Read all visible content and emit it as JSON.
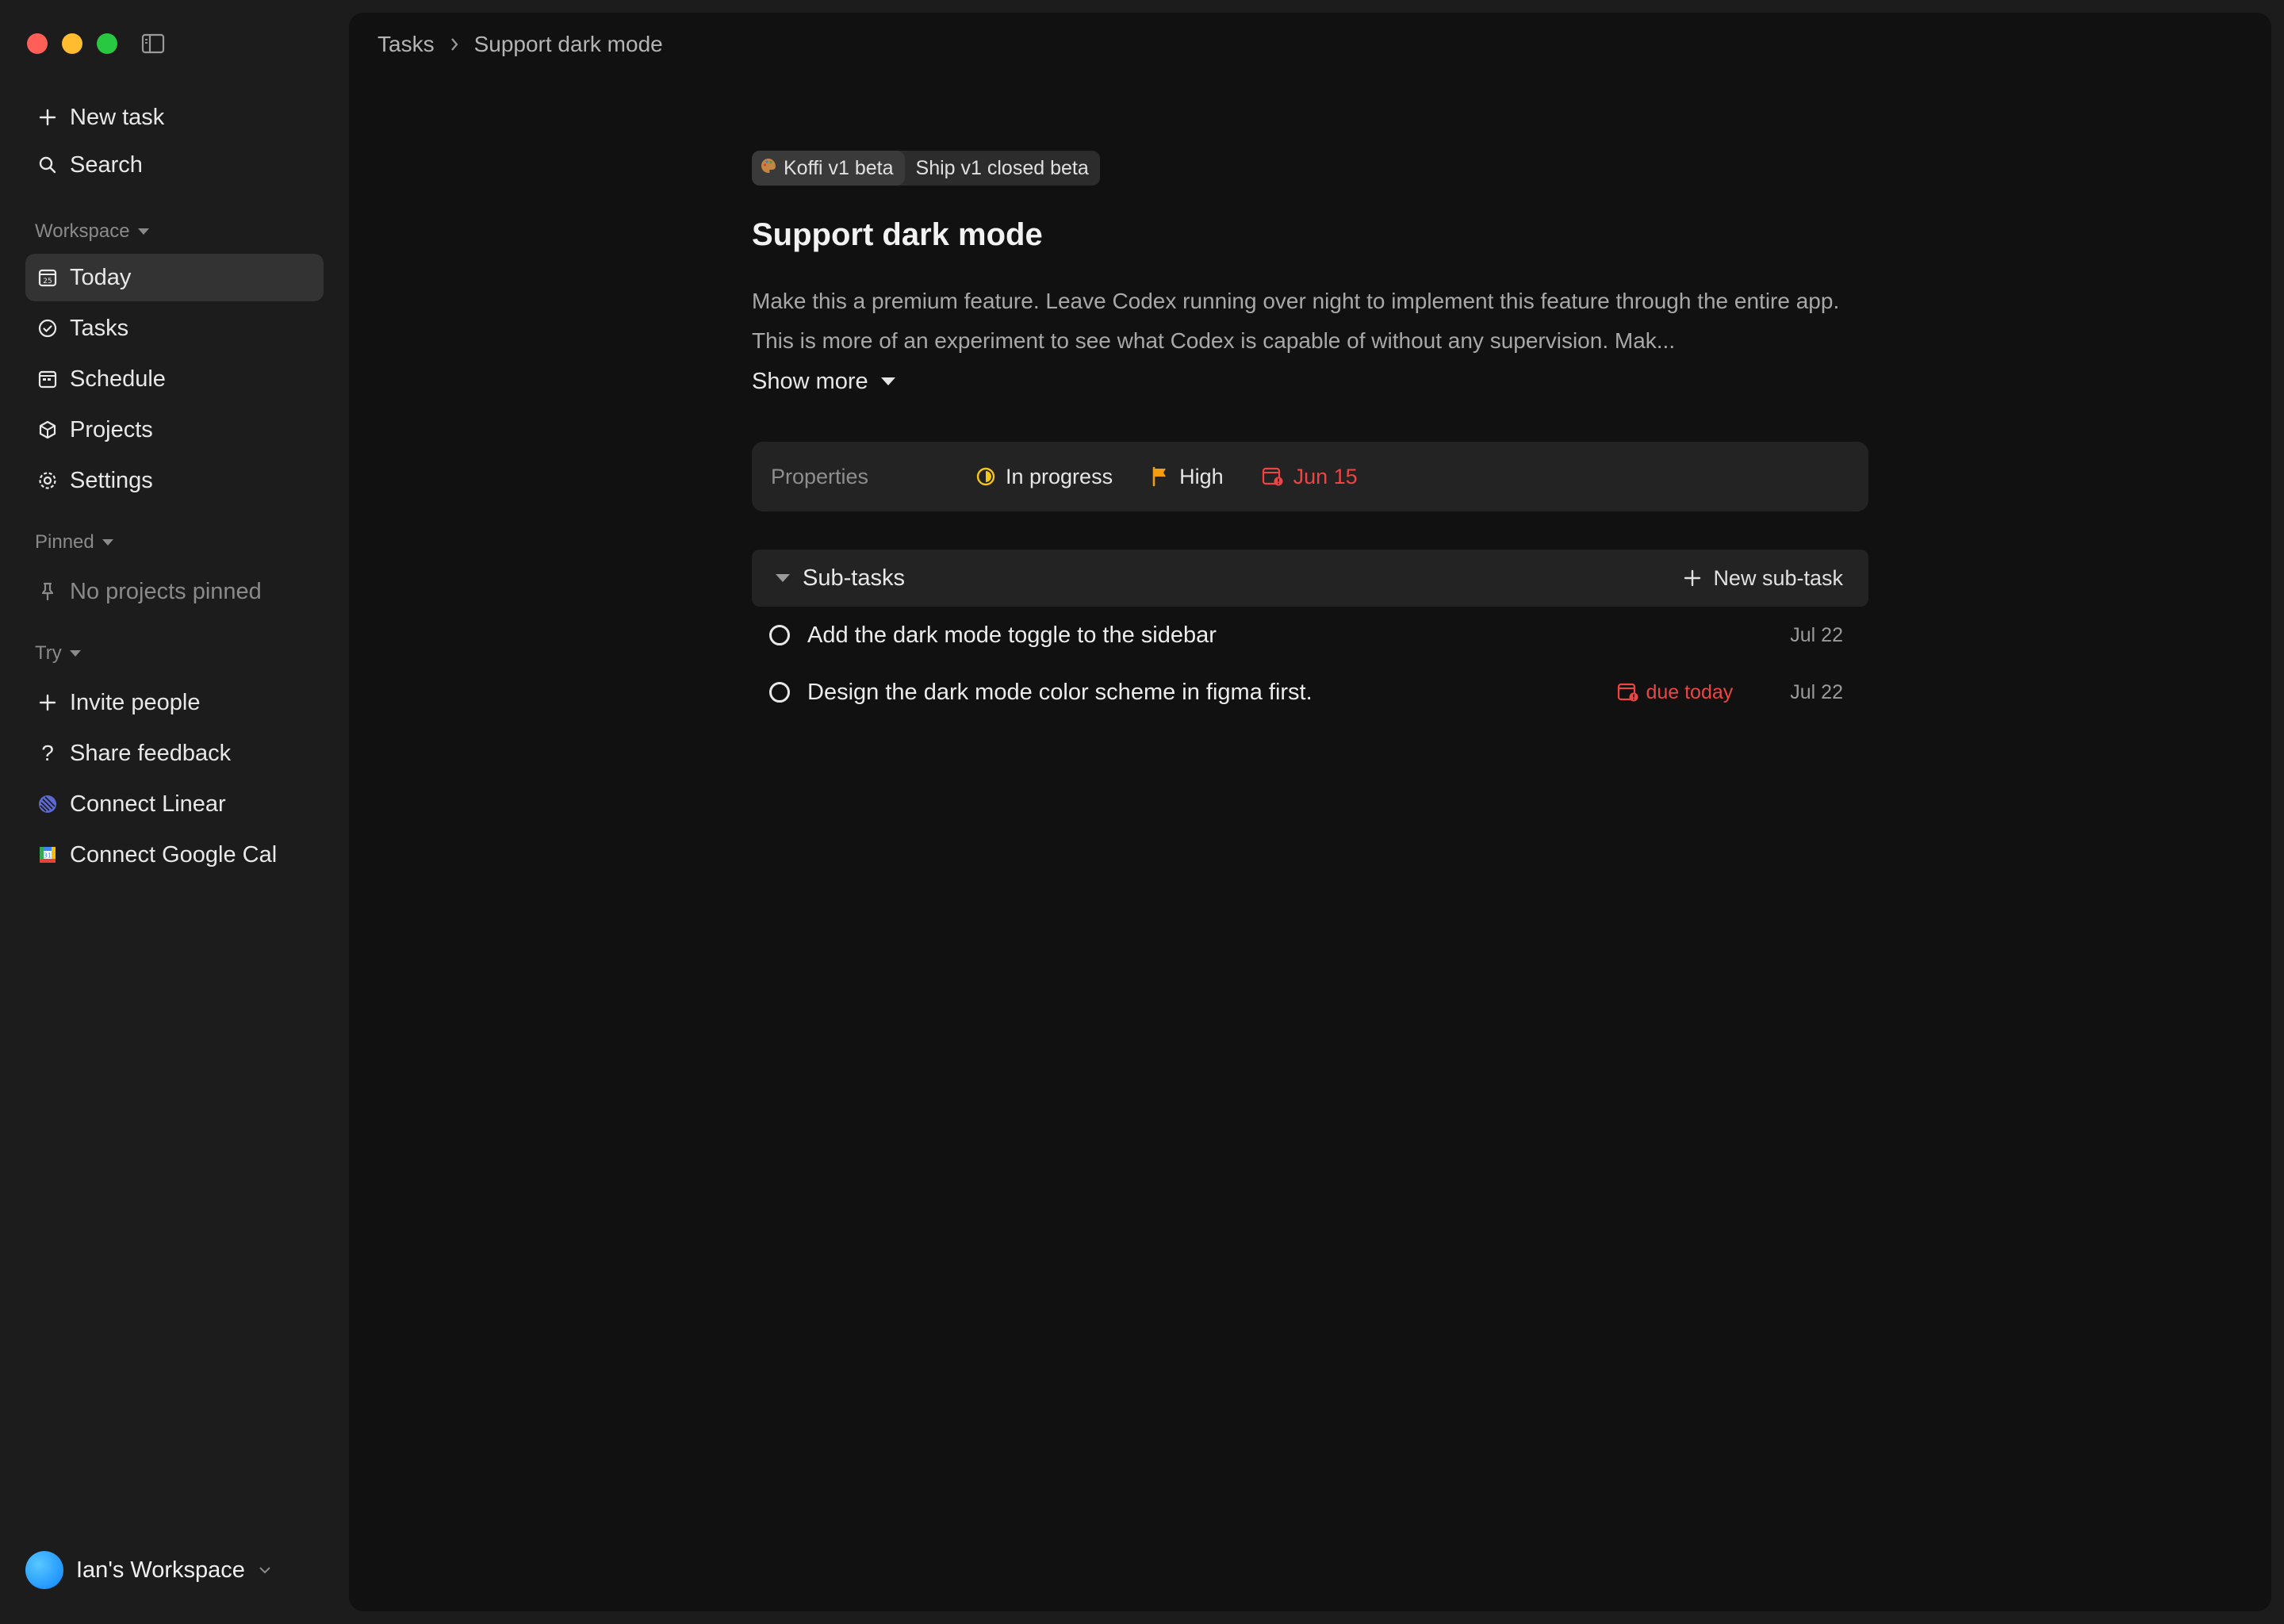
{
  "sidebar": {
    "new_task": "New task",
    "search": "Search",
    "workspace_label": "Workspace",
    "items": [
      {
        "label": "Today"
      },
      {
        "label": "Tasks"
      },
      {
        "label": "Schedule"
      },
      {
        "label": "Projects"
      },
      {
        "label": "Settings"
      }
    ],
    "pinned_label": "Pinned",
    "no_pinned": "No projects pinned",
    "try_label": "Try",
    "try_items": [
      {
        "label": "Invite people"
      },
      {
        "label": "Share feedback"
      },
      {
        "label": "Connect Linear"
      },
      {
        "label": "Connect Google Cal"
      }
    ],
    "workspace_name": "Ian's Workspace"
  },
  "breadcrumb": {
    "root": "Tasks",
    "current": "Support dark mode"
  },
  "task": {
    "project_tag": "Koffi v1 beta",
    "milestone_tag": "Ship v1 closed beta",
    "title": "Support dark mode",
    "description": "Make this a premium feature. Leave Codex running over night to implement this feature through the entire app. This is more of an experiment to see what Codex is capable of without any supervision. Mak...",
    "show_more": "Show more",
    "properties_label": "Properties",
    "status": "In progress",
    "priority": "High",
    "due": "Jun 15"
  },
  "subtasks": {
    "header": "Sub-tasks",
    "new_button": "New sub-task",
    "items": [
      {
        "text": "Add the dark mode toggle to the sidebar",
        "due_label": "",
        "date": "Jul 22"
      },
      {
        "text": "Design the dark mode color scheme in figma first.",
        "due_label": "due today",
        "date": "Jul 22"
      }
    ]
  },
  "colors": {
    "accent_red": "#ef4444",
    "status_yellow": "#f5c518",
    "priority_orange": "#f59e0b"
  }
}
